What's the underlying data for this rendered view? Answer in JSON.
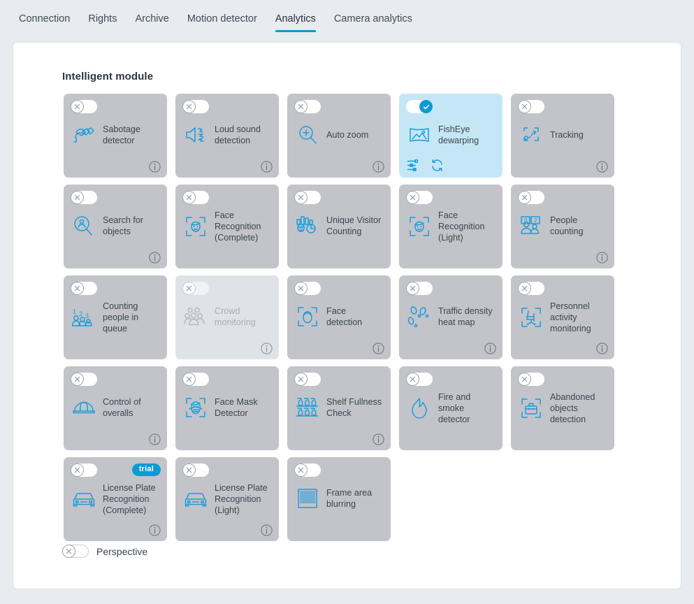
{
  "tabs": [
    {
      "label": "Connection",
      "active": false
    },
    {
      "label": "Rights",
      "active": false
    },
    {
      "label": "Archive",
      "active": false
    },
    {
      "label": "Motion detector",
      "active": false
    },
    {
      "label": "Analytics",
      "active": true
    },
    {
      "label": "Camera analytics",
      "active": false
    }
  ],
  "section": {
    "title": "Intelligent module"
  },
  "colors": {
    "accent": "#0e9ad4",
    "icon_blue": "#1a9ddb",
    "card_bg": "#c3c4c9",
    "card_bg_active": "#c5e7f5",
    "card_bg_disabled": "#dfe3e8",
    "page_bg": "#e8ebef",
    "panel_bg": "#ffffff",
    "text": "#3c4450"
  },
  "modules": [
    {
      "label": "Sabotage detector",
      "icon": "sabotage-detector-icon",
      "enabled": false,
      "disabled": false,
      "info": true,
      "trial": false
    },
    {
      "label": "Loud sound detection",
      "icon": "loud-sound-icon",
      "enabled": false,
      "disabled": false,
      "info": true,
      "trial": false
    },
    {
      "label": "Auto zoom",
      "icon": "auto-zoom-icon",
      "enabled": false,
      "disabled": false,
      "info": true,
      "trial": false
    },
    {
      "label": "FishEye dewarping",
      "icon": "fisheye-dewarping-icon",
      "enabled": true,
      "disabled": false,
      "info": false,
      "trial": false,
      "actions": [
        "settings-sliders-icon",
        "refresh-icon"
      ]
    },
    {
      "label": "Tracking",
      "icon": "tracking-icon",
      "enabled": false,
      "disabled": false,
      "info": true,
      "trial": false
    },
    {
      "label": "Search for objects",
      "icon": "search-objects-icon",
      "enabled": false,
      "disabled": false,
      "info": true,
      "trial": false
    },
    {
      "label": "Face Recognition (Complete)",
      "icon": "face-recognition-icon",
      "enabled": false,
      "disabled": false,
      "info": false,
      "trial": false
    },
    {
      "label": "Unique Visitor Counting",
      "icon": "unique-visitor-counting-icon",
      "enabled": false,
      "disabled": false,
      "info": false,
      "trial": false
    },
    {
      "label": "Face Recognition (Light)",
      "icon": "face-recognition-icon",
      "enabled": false,
      "disabled": false,
      "info": false,
      "trial": false
    },
    {
      "label": "People counting",
      "icon": "people-counting-icon",
      "enabled": false,
      "disabled": false,
      "info": true,
      "trial": false
    },
    {
      "label": "Counting people in queue",
      "icon": "counting-queue-icon",
      "enabled": false,
      "disabled": false,
      "info": false,
      "trial": false
    },
    {
      "label": "Crowd monitoring",
      "icon": "crowd-monitoring-icon",
      "enabled": false,
      "disabled": true,
      "info": true,
      "trial": false
    },
    {
      "label": "Face detection",
      "icon": "face-detection-icon",
      "enabled": false,
      "disabled": false,
      "info": true,
      "trial": false
    },
    {
      "label": "Traffic density heat map",
      "icon": "footprints-icon",
      "enabled": false,
      "disabled": false,
      "info": true,
      "trial": false
    },
    {
      "label": "Personnel activity monitoring",
      "icon": "chair-activity-icon",
      "enabled": false,
      "disabled": false,
      "info": true,
      "trial": false
    },
    {
      "label": "Control of overalls",
      "icon": "hardhat-icon",
      "enabled": false,
      "disabled": false,
      "info": true,
      "trial": false
    },
    {
      "label": "Face Mask Detector",
      "icon": "face-mask-icon",
      "enabled": false,
      "disabled": false,
      "info": false,
      "trial": false
    },
    {
      "label": "Shelf Fullness Check",
      "icon": "shelf-bottles-icon",
      "enabled": false,
      "disabled": false,
      "info": true,
      "trial": false
    },
    {
      "label": "Fire and smoke detector",
      "icon": "flame-icon",
      "enabled": false,
      "disabled": false,
      "info": false,
      "trial": false
    },
    {
      "label": "Abandoned objects detection",
      "icon": "abandoned-object-icon",
      "enabled": false,
      "disabled": false,
      "info": false,
      "trial": false
    },
    {
      "label": "License Plate Recognition (Complete)",
      "icon": "car-plate-icon",
      "enabled": false,
      "disabled": false,
      "info": true,
      "trial": true,
      "trial_label": "trial"
    },
    {
      "label": "License Plate Recognition (Light)",
      "icon": "car-plate-icon",
      "enabled": false,
      "disabled": false,
      "info": true,
      "trial": false
    },
    {
      "label": "Frame area blurring",
      "icon": "frame-blur-icon",
      "enabled": false,
      "disabled": false,
      "info": false,
      "trial": false
    }
  ],
  "perspective": {
    "label": "Perspective",
    "enabled": false
  }
}
